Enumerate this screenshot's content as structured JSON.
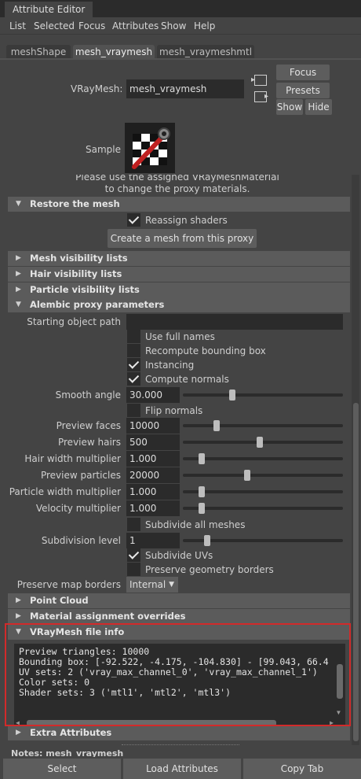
{
  "window": {
    "title": "Attribute Editor"
  },
  "menu": [
    "List",
    "Selected",
    "Focus",
    "Attributes",
    "Show",
    "Help"
  ],
  "tabs": [
    "meshShape",
    "mesh_vraymesh",
    "mesh_vraymeshmtl"
  ],
  "node": {
    "name_label": "VRayMesh:",
    "name_value": "mesh_vraymesh",
    "focus": "Focus",
    "presets": "Presets",
    "show": "Show",
    "hide": "Hide",
    "sample_label": "Sample",
    "note_line1": "Please use the assigned VRayMeshMaterial",
    "note_line2": "to change the proxy materials."
  },
  "sections": {
    "restore": "Restore the mesh",
    "mesh_vis": "Mesh visibility lists",
    "hair_vis": "Hair visibility lists",
    "particle_vis": "Particle visibility lists",
    "alembic": "Alembic proxy parameters",
    "point_cloud": "Point Cloud",
    "material_overrides": "Material assignment overrides",
    "file_info": "VRayMesh file info",
    "extra": "Extra Attributes"
  },
  "restore": {
    "reassign": "Reassign shaders",
    "create_button": "Create a mesh from this proxy"
  },
  "alembic": {
    "start_path_label": "Starting object path",
    "start_path_value": "",
    "use_full_names": "Use full names",
    "recompute_bbox": "Recompute bounding box",
    "instancing": "Instancing",
    "compute_normals": "Compute normals",
    "smooth_angle_label": "Smooth angle",
    "smooth_angle_value": "30.000",
    "flip_normals": "Flip normals",
    "preview_faces_label": "Preview faces",
    "preview_faces_value": "10000",
    "preview_hairs_label": "Preview hairs",
    "preview_hairs_value": "500",
    "hair_width_label": "Hair width multiplier",
    "hair_width_value": "1.000",
    "preview_particles_label": "Preview particles",
    "preview_particles_value": "20000",
    "particle_width_label": "Particle width multiplier",
    "particle_width_value": "1.000",
    "velocity_label": "Velocity multiplier",
    "velocity_value": "1.000",
    "subdivide_all": "Subdivide all meshes",
    "subdiv_level_label": "Subdivision level",
    "subdiv_level_value": "1",
    "subdivide_uvs": "Subdivide UVs",
    "preserve_geo_borders": "Preserve geometry borders",
    "preserve_map_label": "Preserve map borders",
    "preserve_map_value": "Internal"
  },
  "checkbox_states": {
    "reassign": true,
    "use_full_names": false,
    "recompute_bbox": false,
    "instancing": true,
    "compute_normals": true,
    "flip_normals": false,
    "subdivide_all": false,
    "subdivide_uvs": true,
    "preserve_geo_borders": false
  },
  "slider_levels": {
    "smooth_angle": 0.3,
    "preview_faces": 0.2,
    "preview_hairs": 0.48,
    "hair_width": 0.1,
    "preview_particles": 0.4,
    "particle_width": 0.1,
    "velocity": 0.1,
    "subdiv_level": 0.14
  },
  "file_info": {
    "line1": "Preview triangles: 10000",
    "line2": "Bounding box: [-92.522, -4.175, -104.830] - [99.043, 66.4",
    "line3": "UV sets: 2 ('vray_max_channel_0', 'vray_max_channel_1')",
    "line4": "Color sets: 0",
    "line5": "Shader sets: 3 ('mtl1', 'mtl2', 'mtl3')"
  },
  "notes_label": "Notes:  mesh_vraymesh",
  "bottom": {
    "select": "Select",
    "load": "Load Attributes",
    "copy": "Copy Tab"
  },
  "colors": {
    "highlight": "#d22a2a",
    "panel": "#444444",
    "section": "#5b5b5b",
    "field": "#2b2b2b"
  }
}
